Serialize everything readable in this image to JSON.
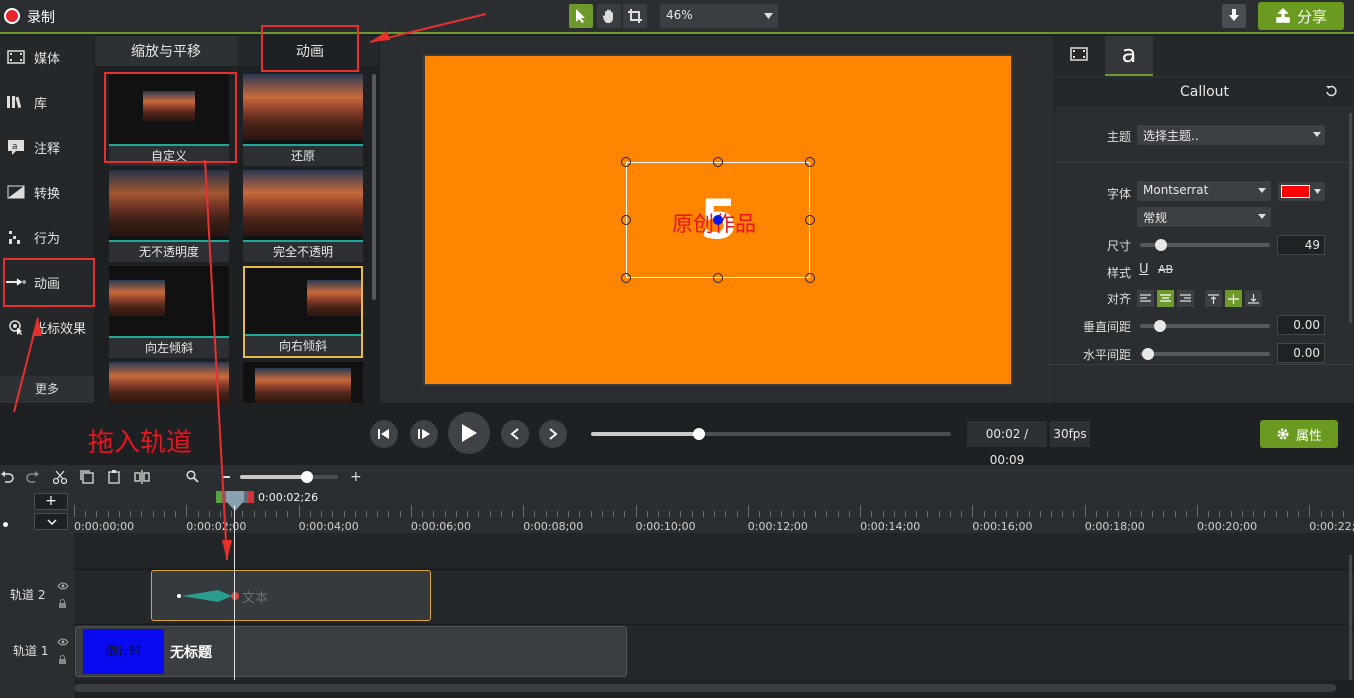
{
  "topbar": {
    "record_label": "录制",
    "zoom_value": "46%",
    "share_label": "分享"
  },
  "sidebar": {
    "items": [
      {
        "label": "媒体",
        "icon": "film-strip-icon"
      },
      {
        "label": "库",
        "icon": "library-books-icon"
      },
      {
        "label": "注释",
        "icon": "annotation-icon"
      },
      {
        "label": "转换",
        "icon": "transition-icon"
      },
      {
        "label": "行为",
        "icon": "behavior-icon"
      },
      {
        "label": "动画",
        "icon": "animation-arrow-icon"
      },
      {
        "label": "光标效果",
        "icon": "cursor-effect-icon"
      }
    ],
    "more_label": "更多"
  },
  "gallery": {
    "tabs": [
      "缩放与平移",
      "动画"
    ],
    "thumbnails": [
      {
        "caption": "自定义"
      },
      {
        "caption": "还原"
      },
      {
        "caption": "无不透明度"
      },
      {
        "caption": "完全不透明"
      },
      {
        "caption": "向左倾斜"
      },
      {
        "caption": "向右倾斜"
      },
      {
        "caption": ""
      },
      {
        "caption": ""
      }
    ]
  },
  "canvas": {
    "background_color": "#ff8400",
    "big_number": "5",
    "callout_text": "原创作品"
  },
  "properties": {
    "title": "Callout",
    "theme_label": "主题",
    "theme_value": "选择主题..",
    "font_label": "字体",
    "font_value": "Montserrat",
    "font_color": "#ff0000",
    "weight_value": "常规",
    "size_label": "尺寸",
    "size_value": "49",
    "style_label": "样式",
    "align_label": "对齐",
    "line_spacing_label": "垂直间距",
    "line_spacing_value": "0.00",
    "char_spacing_label": "水平间距",
    "char_spacing_value": "0.00"
  },
  "playback": {
    "time": "00:02 / 00:09",
    "fps": "30fps",
    "props_label": "属性",
    "progress": 0.3
  },
  "annotation": {
    "drag_hint": "拖入轨道"
  },
  "timeline": {
    "playhead_time": "0:00:02;26",
    "ticks": [
      "0:00:00;00",
      "0:00:02;00",
      "0:00:04;00",
      "0:00:06;00",
      "0:00:08;00",
      "0:00:10;00",
      "0:00:12;00",
      "0:00:14;00",
      "0:00:16;00",
      "0:00:18;00",
      "0:00:20;00",
      "0:00:22;0"
    ],
    "tracks": [
      {
        "label": "轨道 2",
        "clip_label": "文本"
      },
      {
        "label": "轨道 1",
        "clip_label": "无标题",
        "thumb_text": "倒计时"
      }
    ]
  }
}
